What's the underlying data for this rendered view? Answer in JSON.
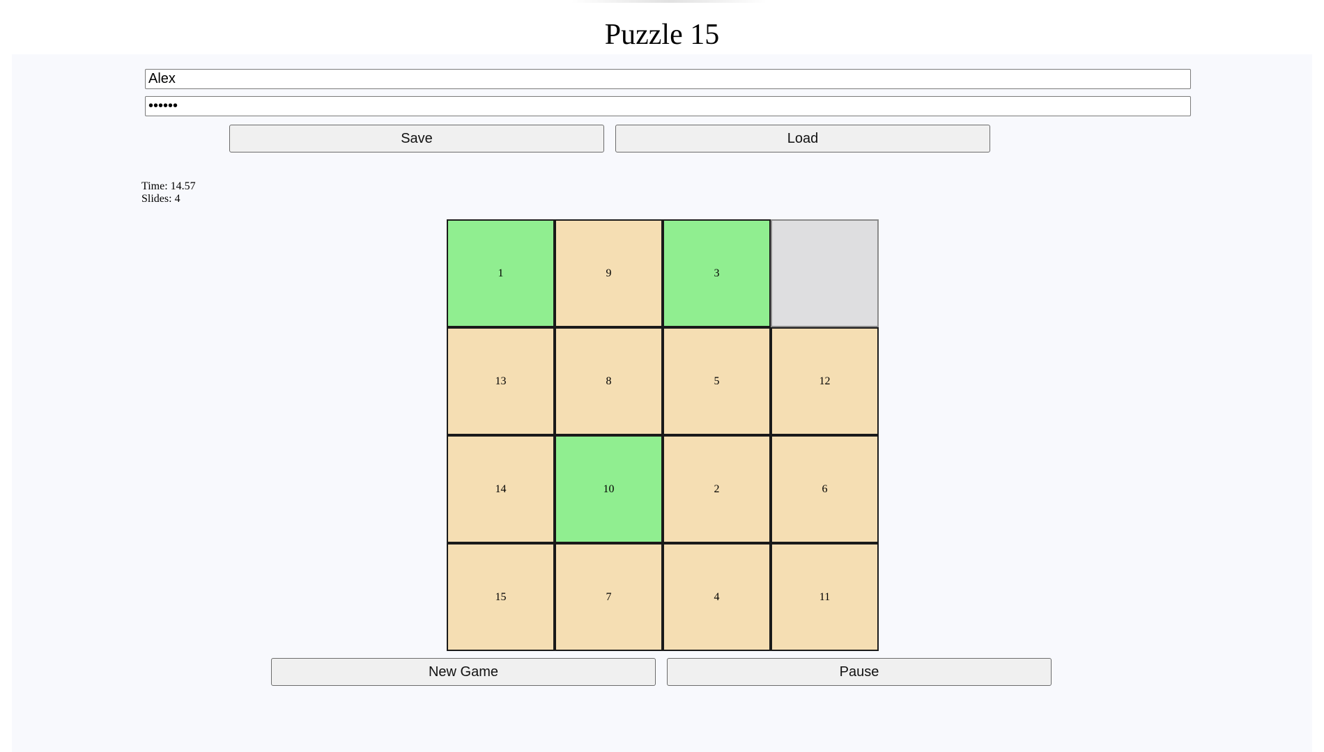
{
  "title": "Puzzle 15",
  "form": {
    "username_value": "Alex",
    "password_value": "secret",
    "save_label": "Save",
    "load_label": "Load"
  },
  "stats": {
    "time_label": "Time: 14.57",
    "slides_label": "Slides: 4"
  },
  "board": {
    "size": 4,
    "colors": {
      "correct": "#90ee90",
      "incorrect": "#f5deb3",
      "empty": "#dedee0"
    },
    "tiles": [
      {
        "value": "1",
        "state": "correct"
      },
      {
        "value": "9",
        "state": "incorrect"
      },
      {
        "value": "3",
        "state": "correct"
      },
      {
        "value": "",
        "state": "empty"
      },
      {
        "value": "13",
        "state": "incorrect"
      },
      {
        "value": "8",
        "state": "incorrect"
      },
      {
        "value": "5",
        "state": "incorrect"
      },
      {
        "value": "12",
        "state": "incorrect"
      },
      {
        "value": "14",
        "state": "incorrect"
      },
      {
        "value": "10",
        "state": "correct"
      },
      {
        "value": "2",
        "state": "incorrect"
      },
      {
        "value": "6",
        "state": "incorrect"
      },
      {
        "value": "15",
        "state": "incorrect"
      },
      {
        "value": "7",
        "state": "incorrect"
      },
      {
        "value": "4",
        "state": "incorrect"
      },
      {
        "value": "11",
        "state": "incorrect"
      }
    ]
  },
  "controls": {
    "new_game_label": "New Game",
    "pause_label": "Pause"
  }
}
